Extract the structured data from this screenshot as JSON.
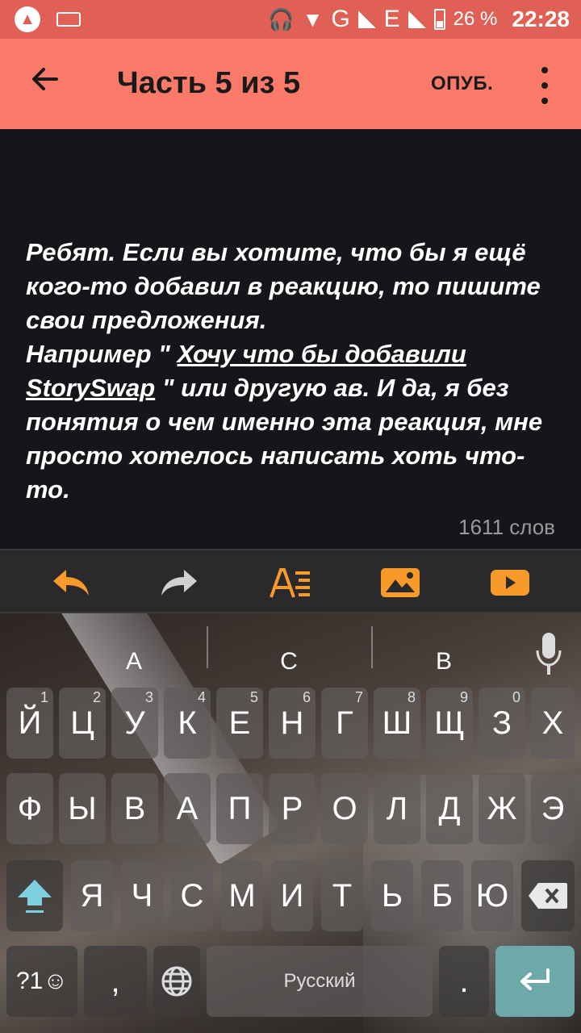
{
  "status_bar": {
    "network": "G",
    "network2": "E",
    "battery": "26 %",
    "time": "22:28"
  },
  "app_bar": {
    "title": "Часть 5 из 5",
    "publish": "ОПУБ."
  },
  "editor": {
    "text_before": "Ребят. Если вы хотите, что бы я ещё кого-то добавил в реакцию, то пишите свои предложения.",
    "text_line2_start": "Например \" ",
    "link_text": "Хочу что бы добавили StorySwap",
    "text_after": " \" или другую ав. И да, я без понятия о чем именно эта реакция, мне просто хотелось написать хоть что-то.",
    "word_count": "1611 слов"
  },
  "toolbar": {
    "items": [
      "undo-icon",
      "redo-icon",
      "text-format-icon",
      "image-icon",
      "video-icon"
    ],
    "accent_color": "#f79a2a",
    "disabled_color": "#d0d0d0"
  },
  "keyboard": {
    "suggestions": [
      "А",
      "С",
      "В"
    ],
    "row1": [
      {
        "label": "Й",
        "hint": "1"
      },
      {
        "label": "Ц",
        "hint": "2"
      },
      {
        "label": "У",
        "hint": "3"
      },
      {
        "label": "К",
        "hint": "4"
      },
      {
        "label": "Е",
        "hint": "5"
      },
      {
        "label": "Н",
        "hint": "6"
      },
      {
        "label": "Г",
        "hint": "7"
      },
      {
        "label": "Ш",
        "hint": "8"
      },
      {
        "label": "Щ",
        "hint": "9"
      },
      {
        "label": "З",
        "hint": "0"
      },
      {
        "label": "Х",
        "hint": ""
      }
    ],
    "row2": [
      "Ф",
      "Ы",
      "В",
      "А",
      "П",
      "Р",
      "О",
      "Л",
      "Д",
      "Ж",
      "Э"
    ],
    "row3": [
      "Я",
      "Ч",
      "С",
      "М",
      "И",
      "Т",
      "Ь",
      "Б",
      "Ю"
    ],
    "symbols_key": "?1☺",
    "comma_key": ",",
    "space_label": "Русский",
    "period_key": "."
  }
}
